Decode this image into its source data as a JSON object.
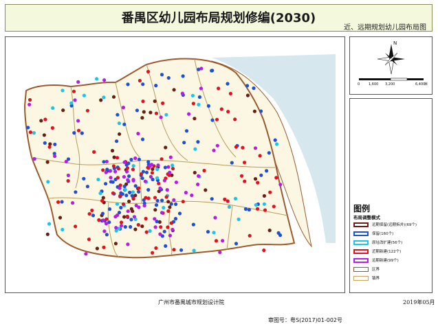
{
  "header": {
    "title": "番禺区幼儿园布局规划修编(2030)",
    "subtitle": "近、远期规划幼儿园布局图"
  },
  "north_arrow": {
    "label": "N"
  },
  "scale_bar": {
    "ticks": [
      "0",
      "1,600",
      "3,200",
      "6,400"
    ],
    "unit": "米"
  },
  "approval": "审图号：粤S(2017)01-002号",
  "legend": {
    "title": "图例",
    "subtitle": "布局调整模式",
    "items": [
      {
        "label": "远期保留(远期拆并)(69个)",
        "color": "#6b1f14",
        "kind": "fill"
      },
      {
        "label": "保留(160个)",
        "color": "#1f4fd6",
        "kind": "fill"
      },
      {
        "label": "原址改扩建(56个)",
        "color": "#19c6e8",
        "kind": "fill"
      },
      {
        "label": "近期新建(122个)",
        "color": "#e3101f",
        "kind": "fill"
      },
      {
        "label": "远期新建(99个)",
        "color": "#b61ce6",
        "kind": "fill"
      },
      {
        "label": "区界",
        "color": "#a0522d",
        "kind": "outline"
      },
      {
        "label": "镇界",
        "color": "#c8a45a",
        "kind": "outline"
      }
    ]
  },
  "footer": {
    "org": "广州市番禺城市规划设计院",
    "date": "2019年05月"
  },
  "colors": {
    "header_bg": "#f4f8dc",
    "land": "#fbf7e2",
    "water": "#d6e8ee",
    "district_boundary": "#9a5a2e",
    "town_boundary": "#b89a5a"
  }
}
